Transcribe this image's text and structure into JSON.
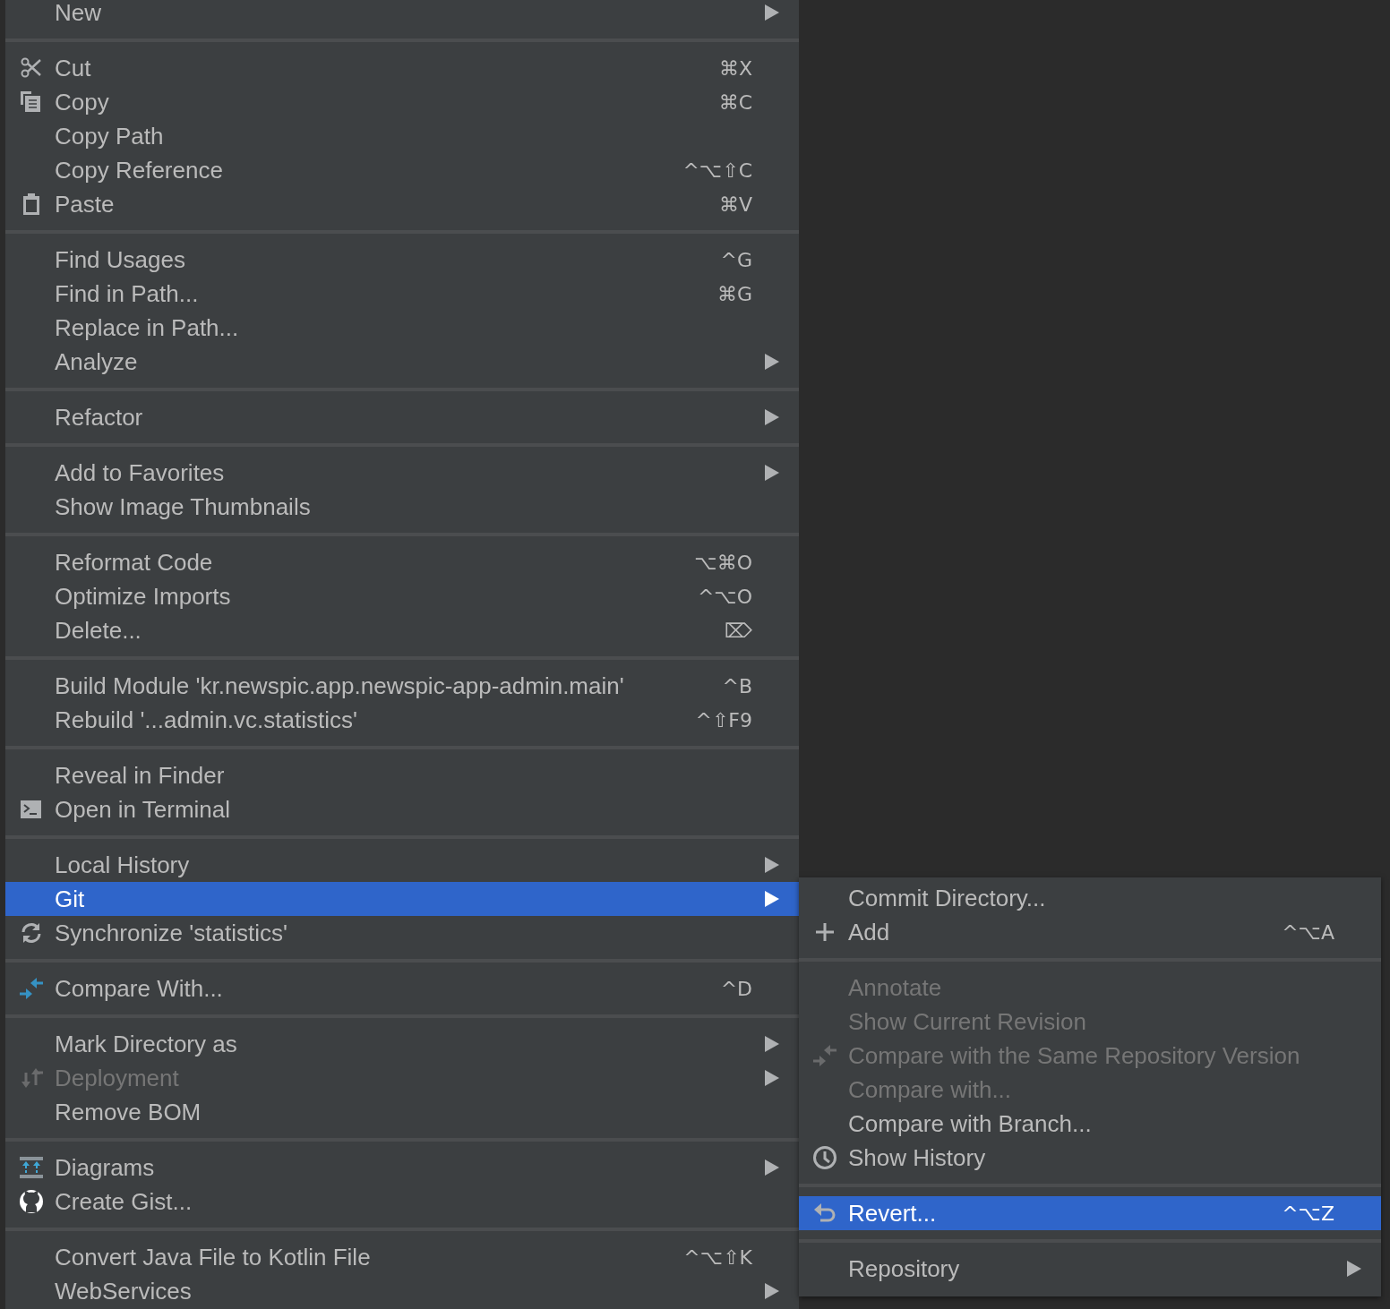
{
  "context_menu": {
    "groups": [
      [
        {
          "label": "New",
          "submenu": true,
          "disabled": false,
          "selected": false
        }
      ],
      [
        {
          "label": "Cut",
          "shortcut": "⌘X",
          "submenu": false,
          "disabled": false,
          "selected": false,
          "kind": "scissors"
        },
        {
          "label": "Copy",
          "shortcut": "⌘C",
          "submenu": false,
          "disabled": false,
          "selected": false,
          "kind": "copy"
        },
        {
          "label": "Copy Path",
          "submenu": false,
          "disabled": false,
          "selected": false
        },
        {
          "label": "Copy Reference",
          "shortcut": "^⌥⇧C",
          "submenu": false,
          "disabled": false,
          "selected": false
        },
        {
          "label": "Paste",
          "shortcut": "⌘V",
          "submenu": false,
          "disabled": false,
          "selected": false,
          "kind": "clipboard"
        }
      ],
      [
        {
          "label": "Find Usages",
          "shortcut": "^G",
          "submenu": false,
          "disabled": false,
          "selected": false
        },
        {
          "label": "Find in Path...",
          "shortcut": "⌘G",
          "submenu": false,
          "disabled": false,
          "selected": false
        },
        {
          "label": "Replace in Path...",
          "submenu": false,
          "disabled": false,
          "selected": false
        },
        {
          "label": "Analyze",
          "submenu": true,
          "disabled": false,
          "selected": false
        }
      ],
      [
        {
          "label": "Refactor",
          "submenu": true,
          "disabled": false,
          "selected": false
        }
      ],
      [
        {
          "label": "Add to Favorites",
          "submenu": true,
          "disabled": false,
          "selected": false
        },
        {
          "label": "Show Image Thumbnails",
          "submenu": false,
          "disabled": false,
          "selected": false
        }
      ],
      [
        {
          "label": "Reformat Code",
          "shortcut": "⌥⌘O",
          "submenu": false,
          "disabled": false,
          "selected": false
        },
        {
          "label": "Optimize Imports",
          "shortcut": "^⌥O",
          "submenu": false,
          "disabled": false,
          "selected": false
        },
        {
          "label": "Delete...",
          "shortcut": "⌦",
          "submenu": false,
          "disabled": false,
          "selected": false
        }
      ],
      [
        {
          "label": "Build Module 'kr.newspic.app.newspic-app-admin.main'",
          "shortcut": "^B",
          "submenu": false,
          "disabled": false,
          "selected": false
        },
        {
          "label": "Rebuild '...admin.vc.statistics'",
          "shortcut": "^⇧F9",
          "submenu": false,
          "disabled": false,
          "selected": false
        }
      ],
      [
        {
          "label": "Reveal in Finder",
          "submenu": false,
          "disabled": false,
          "selected": false
        },
        {
          "label": "Open in Terminal",
          "submenu": false,
          "disabled": false,
          "selected": false,
          "kind": "terminal"
        }
      ],
      [
        {
          "label": "Local History",
          "submenu": true,
          "disabled": false,
          "selected": false
        },
        {
          "label": "Git",
          "submenu": true,
          "disabled": false,
          "selected": true
        },
        {
          "label": "Synchronize 'statistics'",
          "submenu": false,
          "disabled": false,
          "selected": false,
          "kind": "sync"
        }
      ],
      [
        {
          "label": "Compare With...",
          "shortcut": "^D",
          "submenu": false,
          "disabled": false,
          "selected": false,
          "kind": "compare"
        }
      ],
      [
        {
          "label": "Mark Directory as",
          "submenu": true,
          "disabled": false,
          "selected": false
        },
        {
          "label": "Deployment",
          "submenu": true,
          "disabled": true,
          "selected": false,
          "kind": "deploy"
        },
        {
          "label": "Remove BOM",
          "submenu": false,
          "disabled": false,
          "selected": false
        }
      ],
      [
        {
          "label": "Diagrams",
          "submenu": true,
          "disabled": false,
          "selected": false,
          "kind": "diagram"
        },
        {
          "label": "Create Gist...",
          "submenu": false,
          "disabled": false,
          "selected": false,
          "kind": "gist"
        }
      ],
      [
        {
          "label": "Convert Java File to Kotlin File",
          "shortcut": "^⌥⇧K",
          "submenu": false,
          "disabled": false,
          "selected": false
        },
        {
          "label": "WebServices",
          "submenu": true,
          "disabled": false,
          "selected": false
        }
      ]
    ]
  },
  "git_submenu": {
    "groups": [
      [
        {
          "label": "Commit Directory...",
          "submenu": false,
          "disabled": false,
          "selected": false
        },
        {
          "label": "Add",
          "shortcut": "^⌥A",
          "submenu": false,
          "disabled": false,
          "selected": false,
          "kind": "plus"
        }
      ],
      [
        {
          "label": "Annotate",
          "submenu": false,
          "disabled": true,
          "selected": false
        },
        {
          "label": "Show Current Revision",
          "submenu": false,
          "disabled": true,
          "selected": false
        },
        {
          "label": "Compare with the Same Repository Version",
          "submenu": false,
          "disabled": true,
          "selected": false,
          "kind": "compare"
        },
        {
          "label": "Compare with...",
          "submenu": false,
          "disabled": true,
          "selected": false
        },
        {
          "label": "Compare with Branch...",
          "submenu": false,
          "disabled": false,
          "selected": false
        },
        {
          "label": "Show History",
          "submenu": false,
          "disabled": false,
          "selected": false,
          "kind": "clock"
        }
      ],
      [
        {
          "label": "Revert...",
          "shortcut": "^⌥Z",
          "submenu": false,
          "disabled": false,
          "selected": true,
          "kind": "undo"
        }
      ],
      [
        {
          "label": "Repository",
          "submenu": true,
          "disabled": false,
          "selected": false
        }
      ]
    ]
  }
}
